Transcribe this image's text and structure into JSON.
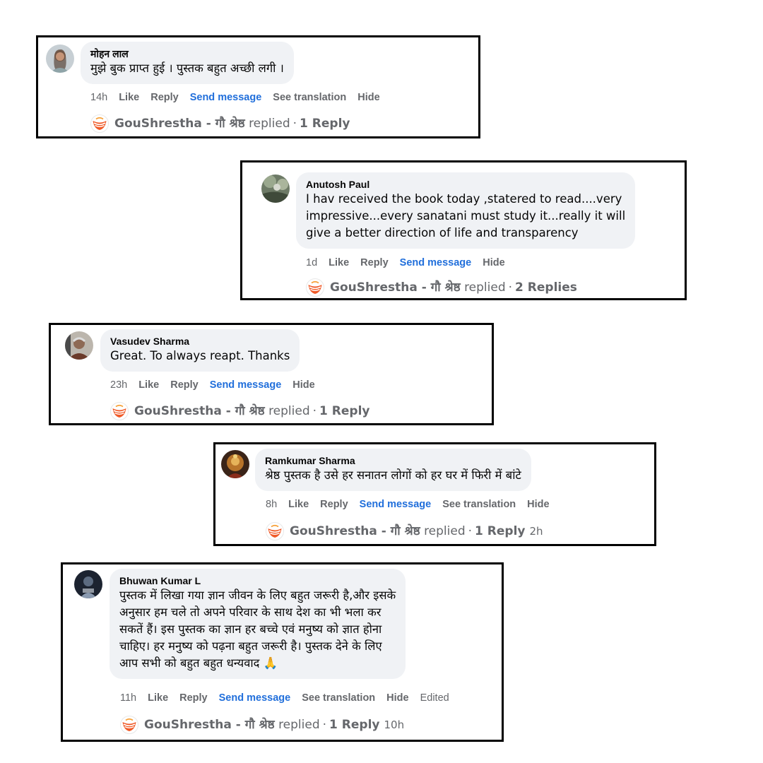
{
  "comments": [
    {
      "author": "मोहन लाल",
      "text": "मुझे बुक प्राप्त हुई । पुस्तक बहुत अच्छी लगी ।",
      "time": "14h",
      "actions": {
        "like": "Like",
        "reply": "Reply",
        "send": "Send message",
        "translate": "See translation",
        "hide": "Hide"
      },
      "reply": {
        "page": "GouShrestha - गौ श्रेष्ठ",
        "verb": "replied",
        "sep": "·",
        "count": "1 Reply"
      }
    },
    {
      "author": "Anutosh Paul",
      "text": "I hav received the book today ,statered to read....very\nimpressive...every sanatani must study it...really it will\ngive a better direction of life and transparency",
      "time": "1d",
      "actions": {
        "like": "Like",
        "reply": "Reply",
        "send": "Send message",
        "hide": "Hide"
      },
      "reply": {
        "page": "GouShrestha - गौ श्रेष्ठ",
        "verb": "replied",
        "sep": "·",
        "count": "2 Replies"
      }
    },
    {
      "author": "Vasudev Sharma",
      "text": "Great. To always reapt. Thanks",
      "time": "23h",
      "actions": {
        "like": "Like",
        "reply": "Reply",
        "send": "Send message",
        "hide": "Hide"
      },
      "reply": {
        "page": "GouShrestha - गौ श्रेष्ठ",
        "verb": "replied",
        "sep": "·",
        "count": "1 Reply"
      }
    },
    {
      "author": "Ramkumar Sharma",
      "text": "श्रेष्ठ पुस्तक है उसे हर सनातन लोगों को हर घर में फिरी में बांटे",
      "time": "8h",
      "actions": {
        "like": "Like",
        "reply": "Reply",
        "send": "Send message",
        "translate": "See translation",
        "hide": "Hide"
      },
      "reply": {
        "page": "GouShrestha - गौ श्रेष्ठ",
        "verb": "replied",
        "sep": "·",
        "count": "1 Reply",
        "time": "2h"
      }
    },
    {
      "author": "Bhuwan Kumar L",
      "text": "पुस्तक में लिखा गया ज्ञान जीवन के लिए बहुत जरूरी है,और इसके\nअनुसार हम चले तो अपने परिवार के साथ देश का भी भला कर\nसकतें हैं। इस पुस्तक का ज्ञान हर बच्चे एवं मनुष्य को ज्ञात होना\nचाहिए। हर मनुष्य को पढ़ना बहुत जरूरी है। पुस्तक देने के लिए\nआप सभी को बहुत बहुत धन्यवाद",
      "emoji": "🙏",
      "time": "11h",
      "actions": {
        "like": "Like",
        "reply": "Reply",
        "send": "Send message",
        "translate": "See translation",
        "hide": "Hide",
        "edited": "Edited"
      },
      "reply": {
        "page": "GouShrestha - गौ श्रेष्ठ",
        "verb": "replied",
        "sep": "·",
        "count": "1 Reply",
        "time": "10h"
      }
    }
  ],
  "colors": {
    "send_message": "#216fdb",
    "muted": "#65676b",
    "bubble": "#f0f2f5",
    "border": "#000000",
    "logo": "#f05a28"
  },
  "icons": {
    "page_logo": "goushrestha-logo-icon",
    "emoji": "folded-hands-icon"
  }
}
